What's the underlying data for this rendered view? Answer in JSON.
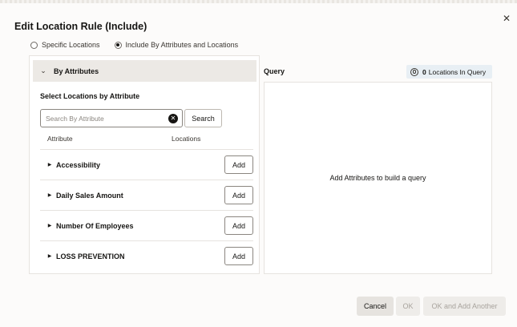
{
  "dialog": {
    "title": "Edit Location Rule (Include)",
    "close_glyph": "✕"
  },
  "mode": {
    "options": [
      {
        "label": "Specific Locations",
        "selected": false
      },
      {
        "label": "Include By Attributes and Locations",
        "selected": true
      }
    ]
  },
  "attributes_panel": {
    "section_title": "By Attributes",
    "chevron_glyph": "⌄",
    "select_label": "Select Locations by Attribute",
    "search": {
      "value": "",
      "placeholder": "Search By Attribute",
      "clear_glyph": "✕",
      "button_label": "Search"
    },
    "columns": [
      "Attribute",
      "Locations"
    ],
    "rows": [
      {
        "name": "Accessibility",
        "button": "Add"
      },
      {
        "name": "Daily Sales Amount",
        "button": "Add"
      },
      {
        "name": "Number Of Employees",
        "button": "Add"
      },
      {
        "name": "LOSS PREVENTION",
        "button": "Add"
      }
    ],
    "caret_glyph": "▶"
  },
  "query_panel": {
    "label": "Query",
    "count": "0",
    "count_suffix": "Locations In Query",
    "empty_text": "Add Attributes to build a query"
  },
  "footer": {
    "cancel": "Cancel",
    "ok": "OK",
    "ok_add_another": "OK and Add Another"
  },
  "icons": {
    "close": "close-icon",
    "chevron": "chevron-down-icon",
    "clear": "clear-icon",
    "caret": "caret-right-icon",
    "locations": "target-icon"
  },
  "colors": {
    "background": "#fcfbfa",
    "panel_header": "#ece9e5",
    "badge": "#e8eff4",
    "disabled_text": "#a8a39d"
  }
}
